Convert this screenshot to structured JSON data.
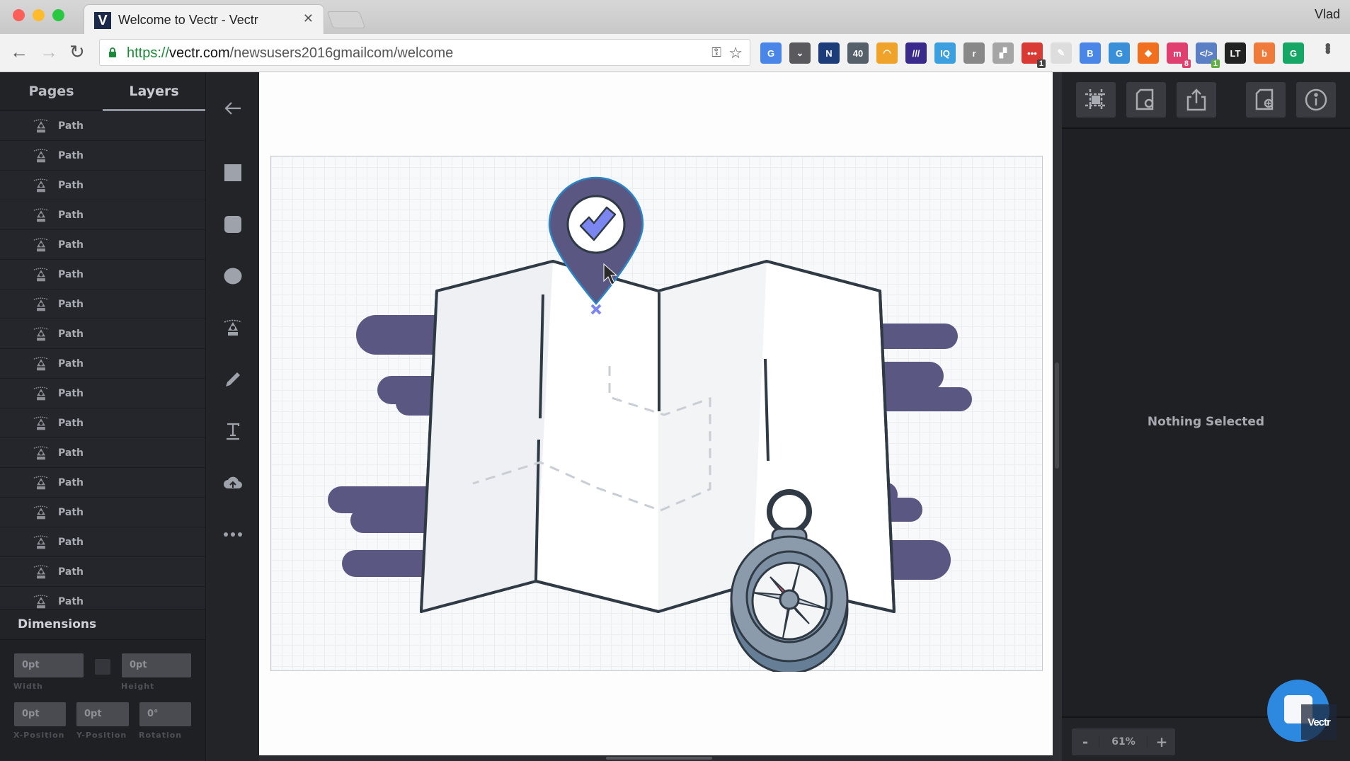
{
  "browser": {
    "tab_title": "Welcome to Vectr - Vectr",
    "tab_favicon": "V",
    "profile_name": "Vlad",
    "url_scheme": "https://",
    "url_domain": "vectr.com",
    "url_path": "/newsusers2016gmailcom/welcome",
    "extensions": [
      {
        "name": "google-translate",
        "glyph": "G",
        "color": "#4a86e8"
      },
      {
        "name": "pocket",
        "glyph": "⌄",
        "color": "#5a5a5e"
      },
      {
        "name": "nimbus",
        "glyph": "N",
        "color": "#1d3d7a"
      },
      {
        "name": "tab-counter",
        "glyph": "40",
        "color": "#55606b"
      },
      {
        "name": "rss",
        "glyph": "◠",
        "color": "#f0a32a"
      },
      {
        "name": "momentum",
        "glyph": "///",
        "color": "#3a2a8c"
      },
      {
        "name": "iq",
        "glyph": "IQ",
        "color": "#3b9fe0"
      },
      {
        "name": "readability",
        "glyph": "r",
        "color": "#888888"
      },
      {
        "name": "cast",
        "glyph": "▞",
        "color": "#a5a5a5"
      },
      {
        "name": "todoist",
        "glyph": "•••",
        "color": "#d93a34",
        "badge": "1",
        "badge_color": "#444444"
      },
      {
        "name": "notes",
        "glyph": "✎",
        "color": "#dddddd"
      },
      {
        "name": "tag",
        "glyph": "B",
        "color": "#4a86e8"
      },
      {
        "name": "grammar-g",
        "glyph": "G",
        "color": "#3a8fd9"
      },
      {
        "name": "fox",
        "glyph": "◆",
        "color": "#f07020"
      },
      {
        "name": "mention",
        "glyph": "m",
        "color": "#e04070",
        "badge": "8",
        "badge_color": "#e0406e"
      },
      {
        "name": "code",
        "glyph": "</>",
        "color": "#5b7fc4",
        "badge": "1",
        "badge_color": "#5fb040"
      },
      {
        "name": "languagetool",
        "glyph": "LT",
        "color": "#222222"
      },
      {
        "name": "honey",
        "glyph": "b",
        "color": "#f07a3a"
      },
      {
        "name": "grammarly",
        "glyph": "G",
        "color": "#16a665"
      }
    ]
  },
  "left_panel": {
    "tabs": [
      {
        "label": "Pages",
        "active": false
      },
      {
        "label": "Layers",
        "active": true
      }
    ],
    "layers": [
      {
        "label": "Path"
      },
      {
        "label": "Path"
      },
      {
        "label": "Path"
      },
      {
        "label": "Path"
      },
      {
        "label": "Path"
      },
      {
        "label": "Path"
      },
      {
        "label": "Path"
      },
      {
        "label": "Path"
      },
      {
        "label": "Path"
      },
      {
        "label": "Path"
      },
      {
        "label": "Path"
      },
      {
        "label": "Path"
      },
      {
        "label": "Path"
      },
      {
        "label": "Path"
      },
      {
        "label": "Path"
      },
      {
        "label": "Path"
      },
      {
        "label": "Path"
      }
    ],
    "dimensions": {
      "title": "Dimensions",
      "width": {
        "value": "0pt",
        "label": "Width"
      },
      "height": {
        "value": "0pt",
        "label": "Height"
      },
      "x": {
        "value": "0pt",
        "label": "X-Position"
      },
      "y": {
        "value": "0pt",
        "label": "Y-Position"
      },
      "rotation": {
        "value": "0°",
        "label": "Rotation"
      }
    }
  },
  "tools": [
    "back",
    "rectangle",
    "rounded-rectangle",
    "ellipse",
    "pen",
    "pencil",
    "text",
    "upload",
    "more"
  ],
  "right_panel": {
    "header_buttons": [
      "grid-settings",
      "document-settings",
      "export",
      "new-page",
      "info"
    ],
    "empty_state": "Nothing Selected",
    "zoom": {
      "minus": "-",
      "value": "61%",
      "plus": "+"
    }
  },
  "badge": {
    "label": "Vectr"
  },
  "colors": {
    "accent_purple": "#5a5783",
    "check_blue": "#7b86f0",
    "outline": "#2f3a45",
    "compass_gray": "#8b9bab",
    "compass_dark": "#667f96",
    "needle_red": "#e8566a",
    "needle_blue": "#5aaee8"
  }
}
